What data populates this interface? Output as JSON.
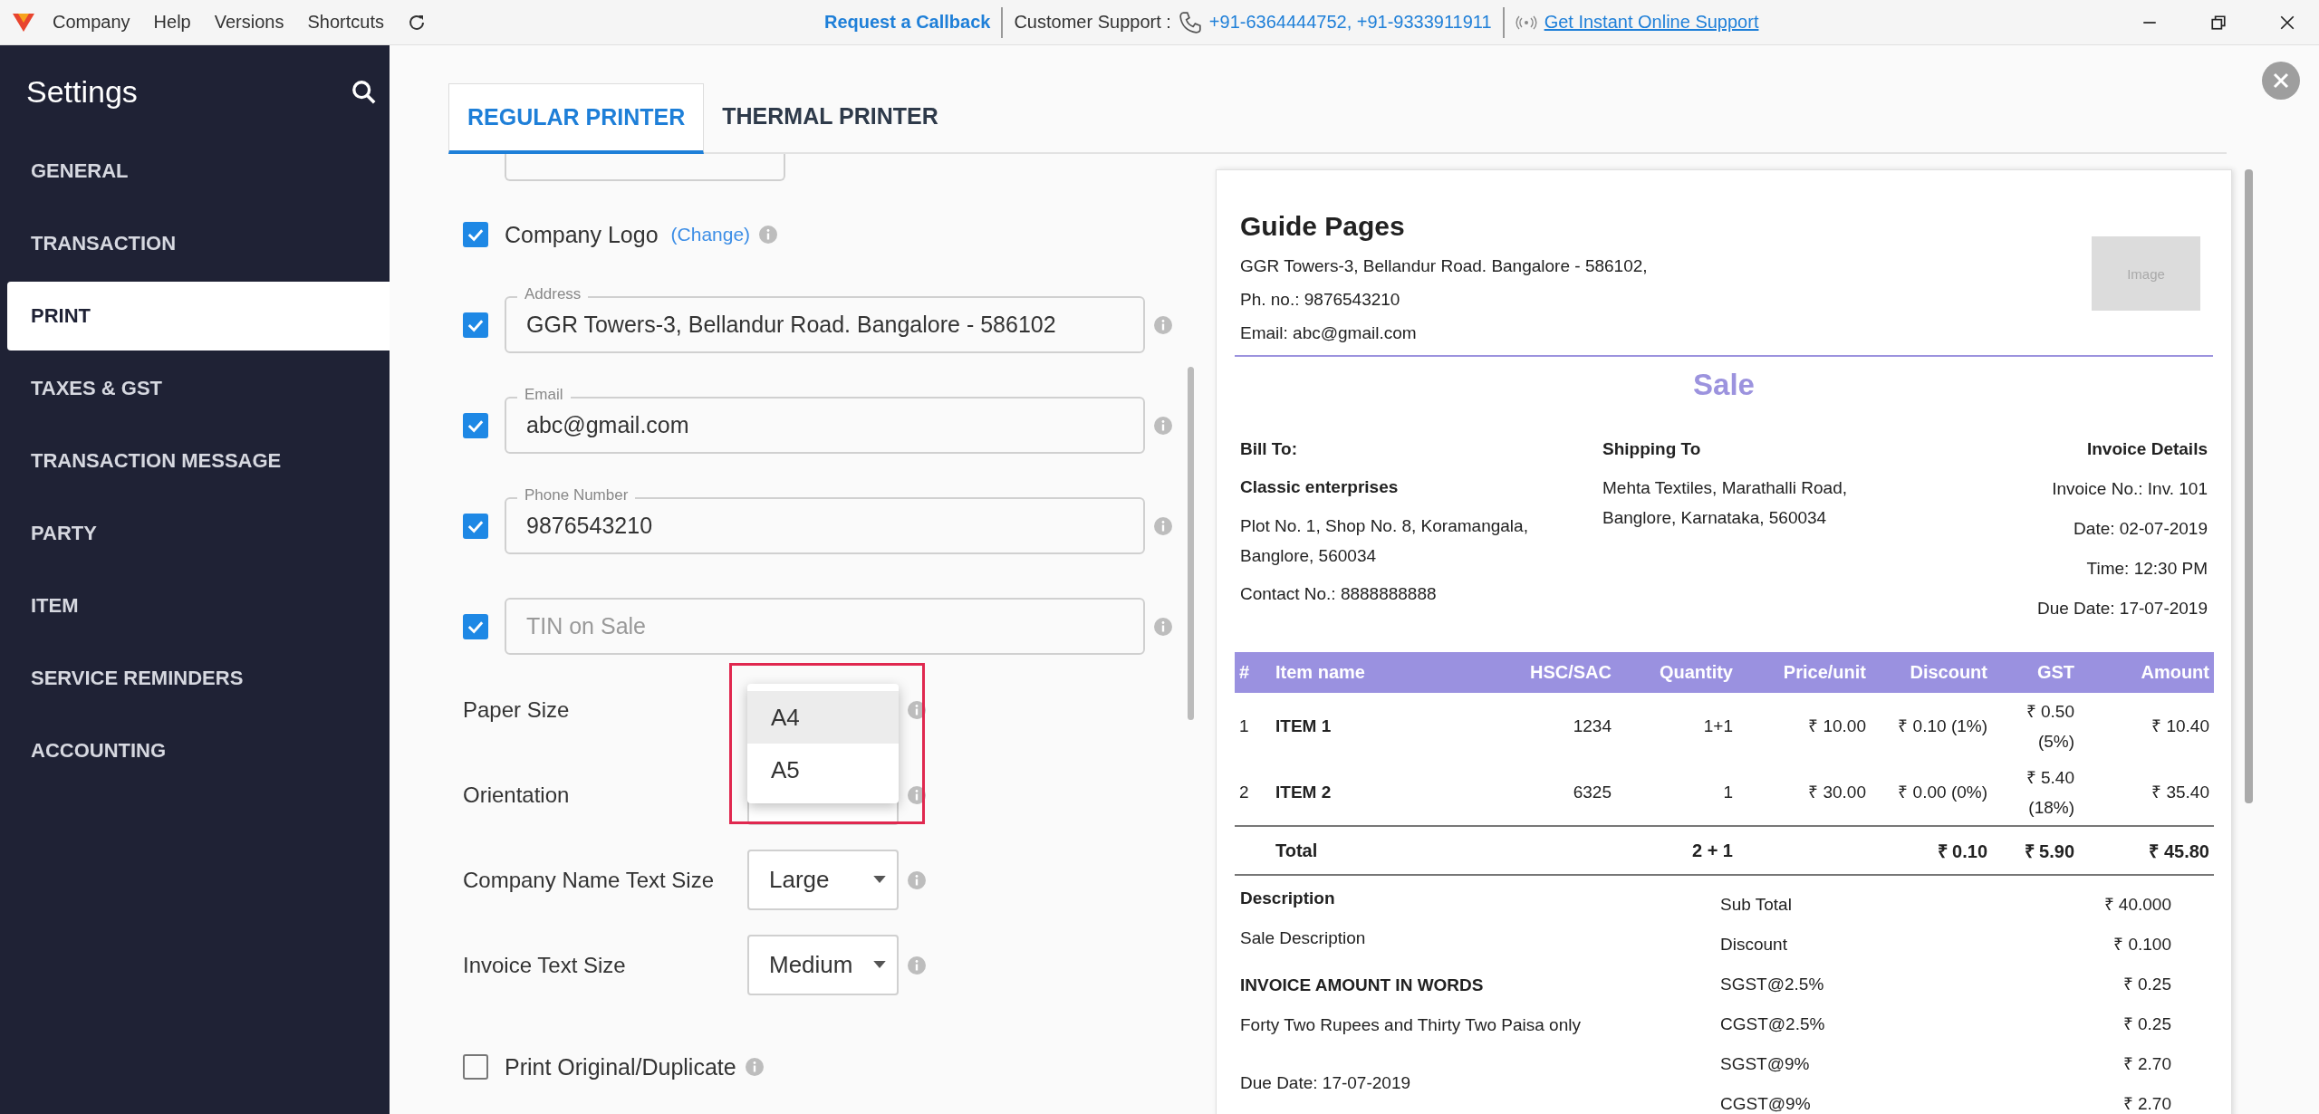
{
  "top_bar": {
    "menu": [
      "Company",
      "Help",
      "Versions",
      "Shortcuts"
    ],
    "callback": "Request a Callback",
    "support_label": "Customer Support :",
    "phones": "+91-6364444752, +91-9333911911",
    "online_support": "Get Instant Online Support"
  },
  "sidebar": {
    "title": "Settings",
    "items": [
      {
        "label": "GENERAL",
        "selected": false
      },
      {
        "label": "TRANSACTION",
        "selected": false
      },
      {
        "label": "PRINT",
        "selected": true
      },
      {
        "label": "TAXES & GST",
        "selected": false
      },
      {
        "label": "TRANSACTION MESSAGE",
        "selected": false
      },
      {
        "label": "PARTY",
        "selected": false
      },
      {
        "label": "ITEM",
        "selected": false
      },
      {
        "label": "SERVICE REMINDERS",
        "selected": false
      },
      {
        "label": "ACCOUNTING",
        "selected": false
      }
    ]
  },
  "tabs": [
    {
      "label": "REGULAR PRINTER",
      "selected": true
    },
    {
      "label": "THERMAL PRINTER",
      "selected": false
    }
  ],
  "form": {
    "rows": [
      {
        "kind": "checkbox",
        "label": "Company Logo",
        "link": "(Change)",
        "checked": true
      },
      {
        "kind": "field",
        "checked": true,
        "label": "Address",
        "value": "GGR Towers-3, Bellandur Road. Bangalore - 586102"
      },
      {
        "kind": "field",
        "checked": true,
        "label": "Email",
        "value": "abc@gmail.com"
      },
      {
        "kind": "field",
        "checked": true,
        "label": "Phone Number",
        "value": "9876543210"
      },
      {
        "kind": "field",
        "checked": true,
        "placeholder": "TIN on Sale"
      },
      {
        "kind": "select",
        "label": "Paper Size",
        "menu": [
          {
            "label": "A4",
            "selected": true
          },
          {
            "label": "A5",
            "selected": false
          }
        ]
      },
      {
        "kind": "select",
        "label": "Orientation"
      },
      {
        "kind": "select",
        "label": "Company Name Text Size",
        "value": "Large"
      },
      {
        "kind": "select",
        "label": "Invoice Text Size",
        "value": "Medium"
      },
      {
        "kind": "checkbox",
        "label": "Print Original/Duplicate",
        "checked": false
      }
    ]
  },
  "preview": {
    "company": "Guide Pages",
    "address": "GGR Towers-3, Bellandur Road. Bangalore - 586102,",
    "phone": "Ph. no.: 9876543210",
    "email": "Email: abc@gmail.com",
    "logo_placeholder": "Image",
    "title": "Sale",
    "bill_to": {
      "heading": "Bill To:",
      "name": "Classic enterprises",
      "address": "Plot No. 1, Shop No. 8, Koramangala, Banglore, 560034",
      "contact": "Contact No.: 8888888888"
    },
    "shipping_to": {
      "heading": "Shipping To",
      "address": "Mehta Textiles, Marathalli Road, Banglore, Karnataka, 560034"
    },
    "invoice_details": {
      "heading": "Invoice Details",
      "lines": [
        "Invoice No.: Inv. 101",
        "Date: 02-07-2019",
        "Time: 12:30 PM",
        "Due Date: 17-07-2019"
      ]
    },
    "table": {
      "columns": [
        "#",
        "Item name",
        "HSC/SAC",
        "Quantity",
        "Price/unit",
        "Discount",
        "GST",
        "Amount"
      ],
      "rows": [
        [
          "1",
          "ITEM 1",
          "1234",
          "1+1",
          "₹ 10.00",
          "₹ 0.10 (1%)",
          "₹ 0.50 (5%)",
          "₹ 10.40"
        ],
        [
          "2",
          "ITEM 2",
          "6325",
          "1",
          "₹ 30.00",
          "₹ 0.00 (0%)",
          "₹ 5.40 (18%)",
          "₹ 35.40"
        ]
      ],
      "total": {
        "label": "Total",
        "quantity": "2 + 1",
        "discount": "₹ 0.10",
        "gst": "₹ 5.90",
        "amount": "₹ 45.80"
      }
    },
    "description": {
      "heading": "Description",
      "text": "Sale Description"
    },
    "amount_in_words": {
      "heading": "INVOICE AMOUNT IN WORDS",
      "text": "Forty Two Rupees and Thirty Two Paisa only"
    },
    "due_date": "Due Date: 17-07-2019",
    "summary": [
      {
        "label": "Sub Total",
        "amount": "₹ 40.000"
      },
      {
        "label": "Discount",
        "amount": "₹ 0.100"
      },
      {
        "label": "SGST@2.5%",
        "amount": "₹ 0.25"
      },
      {
        "label": "CGST@2.5%",
        "amount": "₹ 0.25"
      },
      {
        "label": "SGST@9%",
        "amount": "₹ 2.70"
      },
      {
        "label": "CGST@9%",
        "amount": "₹ 2.70"
      }
    ]
  }
}
